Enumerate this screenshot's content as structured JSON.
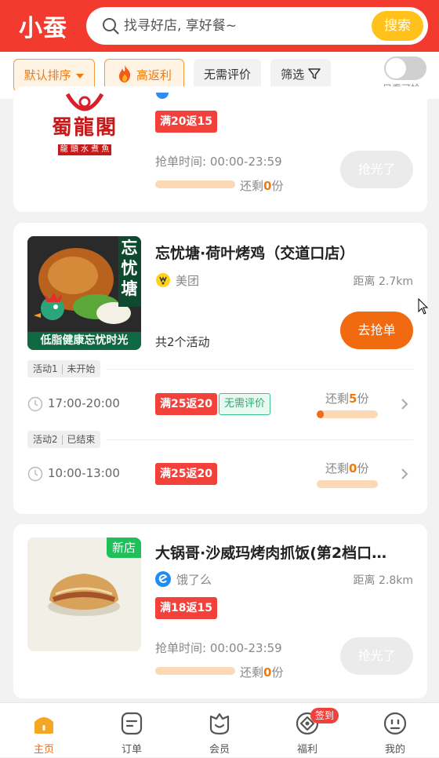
{
  "header": {
    "logo": "小蚕",
    "search_placeholder": "找寻好店, 享好餐~",
    "search_button": "搜索"
  },
  "filters": {
    "sort": "默认排序",
    "high_rebate": "高返利",
    "no_review": "无需评价",
    "filter": "筛选",
    "only_grabbable": "只看可抢"
  },
  "stores": [
    {
      "logo_text": "蜀龍閣",
      "logo_sub": "龍 頭 水 煮 魚",
      "promo": "满20返15",
      "time_label": "抢单时间: 00:00-23:59",
      "remain_prefix": "还剩",
      "remain_count": "0",
      "remain_suffix": "份",
      "progress": 0,
      "button": "抢光了"
    },
    {
      "name": "忘忧塘·荷叶烤鸡（交道口店）",
      "thumb_text_top": "忘忧塘",
      "thumb_text_bottom": "低脂健康忘忧时光",
      "platform": "美团",
      "distance": "距离 2.7km",
      "activity_count": "共2个活动",
      "button": "去抢单",
      "activities": [
        {
          "label": "活动1",
          "status": "未开始",
          "time": "17:00-20:00",
          "promo": "满25返20",
          "tag": "无需评价",
          "remain_prefix": "还剩",
          "remain_count": "5",
          "remain_suffix": "份",
          "progress": 0.12
        },
        {
          "label": "活动2",
          "status": "已结束",
          "time": "10:00-13:00",
          "promo": "满25返20",
          "remain_prefix": "还剩",
          "remain_count": "0",
          "remain_suffix": "份",
          "progress": 0
        }
      ]
    },
    {
      "name": "大锅哥·沙威玛烤肉抓饭(第2档口…",
      "new_tag": "新店",
      "platform": "饿了么",
      "distance": "距离 2.8km",
      "promo": "满18返15",
      "time_label": "抢单时间: 00:00-23:59",
      "remain_prefix": "还剩",
      "remain_count": "0",
      "remain_suffix": "份",
      "progress": 0,
      "button": "抢光了"
    }
  ],
  "nav": [
    {
      "label": "主页",
      "icon": "home-icon"
    },
    {
      "label": "订单",
      "icon": "order-icon"
    },
    {
      "label": "会员",
      "icon": "member-icon"
    },
    {
      "label": "福利",
      "icon": "gift-icon",
      "badge": "签到"
    },
    {
      "label": "我的",
      "icon": "profile-icon"
    }
  ],
  "colors": {
    "brand": "#f23a2f",
    "accent": "#f26a10",
    "search_button": "#ffc11a",
    "active_nav": "#f26a10"
  }
}
